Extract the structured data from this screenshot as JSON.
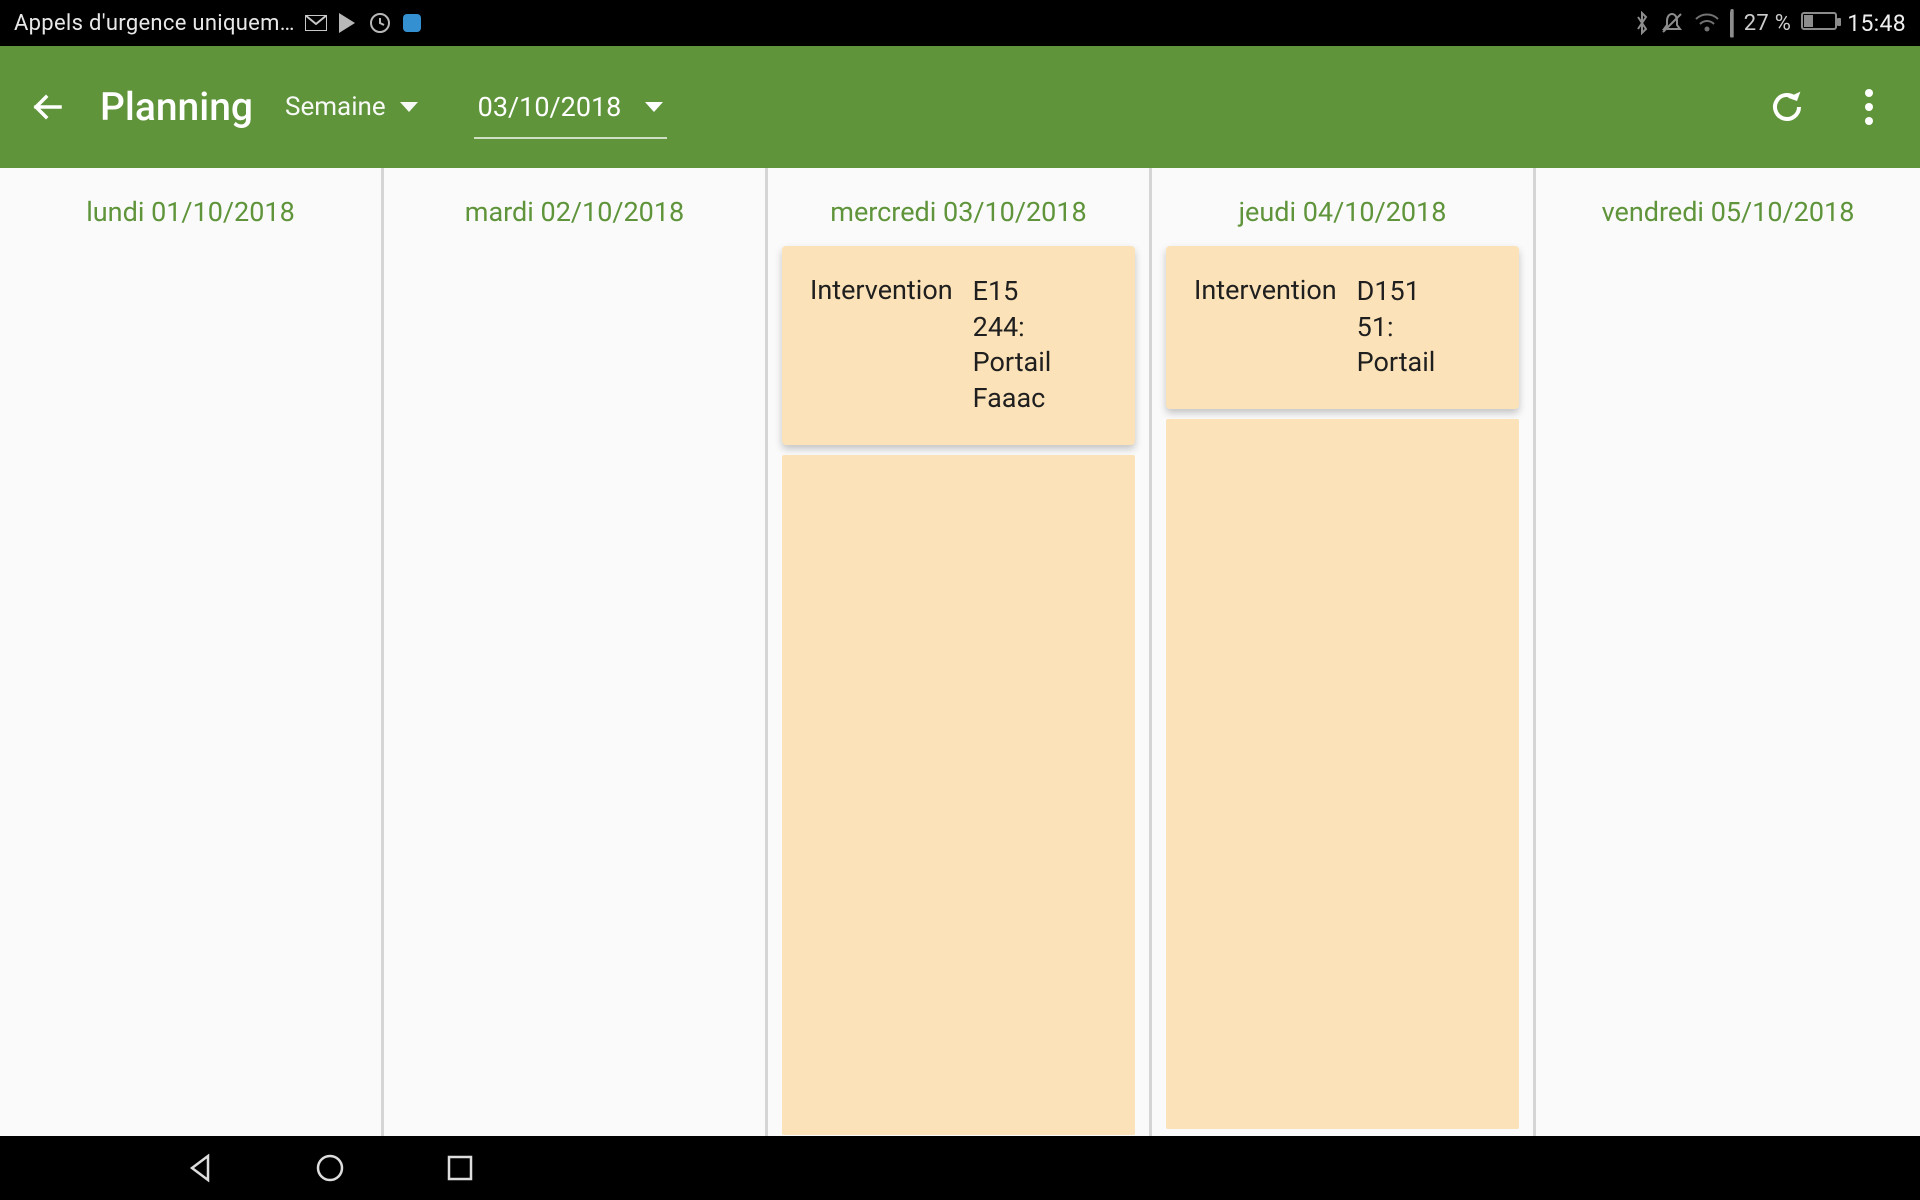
{
  "status": {
    "text": "Appels d'urgence uniquem…",
    "battery_pct": "27 %",
    "time": "15:48"
  },
  "appbar": {
    "title": "Planning",
    "view_mode": "Semaine",
    "date": "03/10/2018"
  },
  "week": {
    "days": [
      {
        "label": "lundi 01/10/2018",
        "highlight": false,
        "events": []
      },
      {
        "label": "mardi 02/10/2018",
        "highlight": false,
        "events": []
      },
      {
        "label": "mercredi 03/10/2018",
        "highlight": true,
        "events": [
          {
            "title": "Intervention",
            "detail": "E15\n244:\nPortail\nFaaac",
            "tall": true
          }
        ]
      },
      {
        "label": "jeudi 04/10/2018",
        "highlight": true,
        "events": [
          {
            "title": "Intervention",
            "detail": "D151\n51:\nPortail",
            "tall": false
          }
        ]
      },
      {
        "label": "vendredi 05/10/2018",
        "highlight": false,
        "events": []
      }
    ]
  }
}
